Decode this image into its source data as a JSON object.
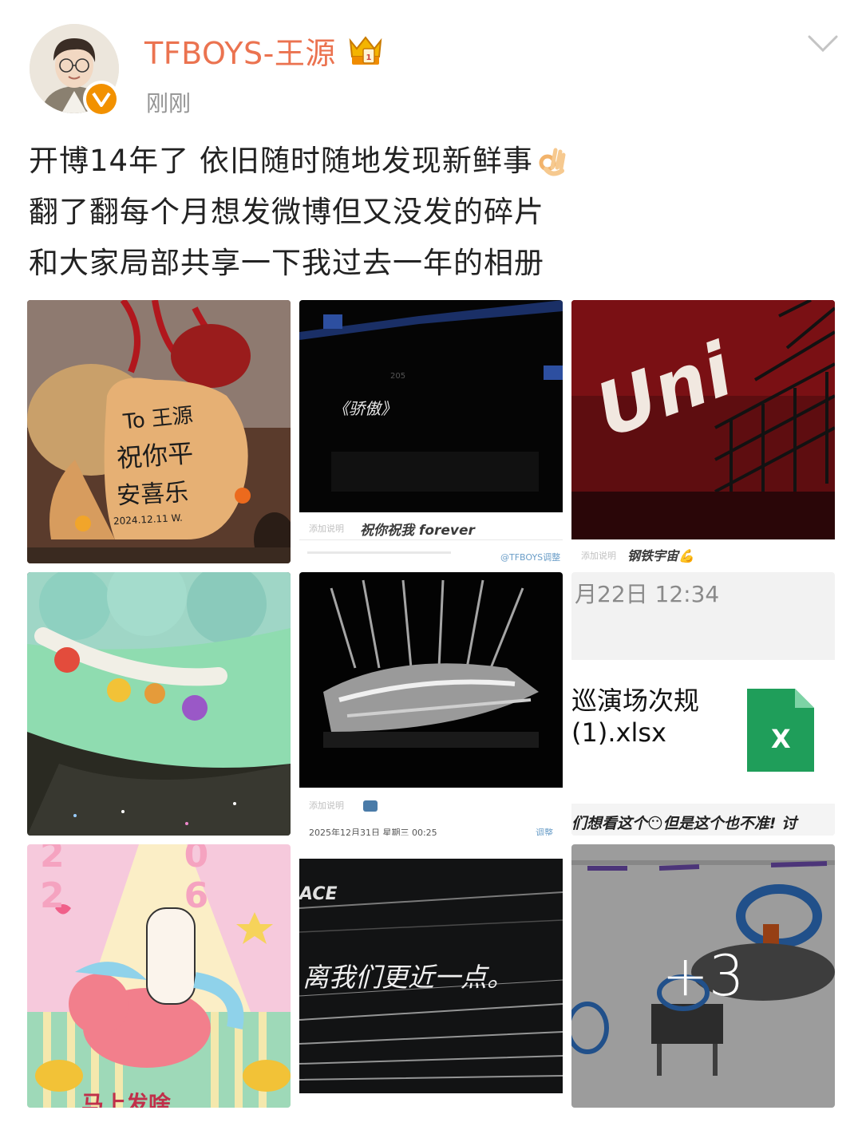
{
  "post": {
    "author": "TFBOYS-王源",
    "time": "刚刚",
    "text_lines": [
      "开博14年了 依旧随时随地发现新鲜事",
      "翻了翻每个月想发微博但又没发的碎片",
      "和大家局部共享一下我过去一年的相册"
    ],
    "emoji": "ok-hand-icon"
  },
  "images": {
    "img1": {
      "fan_text_1": "To 王源",
      "fan_text_2": "祝你平",
      "fan_text_3": "安喜乐",
      "fan_sign": "2024.12.11 W."
    },
    "img2": {
      "screen_title": "《骄傲》",
      "screen_small": "205",
      "caption_hint": "添加说明",
      "caption": "祝你祝我 forever",
      "footer": "@TFBOYS调整",
      "link": "调整"
    },
    "img3": {
      "logo": "Uni",
      "caption_hint": "添加说明",
      "caption": "钢铁宇宙💪"
    },
    "img4": {},
    "img5": {
      "caption_hint": "添加说明",
      "footer_date": "2025年12月31日 星期三 00:25",
      "link": "调整"
    },
    "img6": {
      "date_time": "月22日 12:34",
      "file_name_1": "巡演场次规",
      "file_name_2": "(1).xlsx",
      "file_icon_letter": "X",
      "bottom_text": "们想看这个😶但是这个也不准! 讨"
    },
    "img7": {
      "top_text": "20 26",
      "bottom_text": "马上发啥"
    },
    "img8": {
      "top_text": "ACE",
      "screen_text": "离我们更近一点。"
    },
    "img9": {
      "more_count": "+3"
    }
  },
  "colors": {
    "username": "#eb7350",
    "time": "#939393",
    "text": "#222222",
    "verified": "#f29100",
    "excel_green": "#1f9e5a"
  }
}
